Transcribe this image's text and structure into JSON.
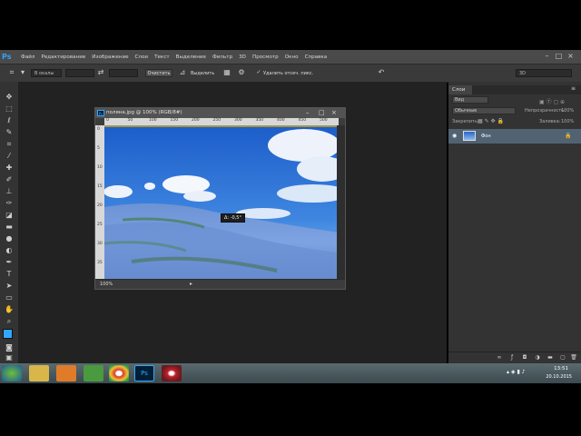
{
  "app": {
    "logo": "Ps",
    "menu": [
      "Файл",
      "Редактирование",
      "Изображение",
      "Слои",
      "Текст",
      "Выделение",
      "Фильтр",
      "3D",
      "Просмотр",
      "Окно",
      "Справка"
    ]
  },
  "options_bar": {
    "feather_label": "В окалы",
    "refine_button": "Очистить",
    "select_button": "Выделить",
    "checkbox_label": "Удалить отсеч. пикс.",
    "workspace_value": "3D"
  },
  "document": {
    "title": "поляна.jpg @ 100% (RGB/8#)",
    "zoom": "100%",
    "tooltip": "Δ: -0,5°",
    "ruler_top": [
      "0",
      "50",
      "100",
      "150",
      "200",
      "250",
      "300",
      "350",
      "400",
      "450",
      "500"
    ],
    "ruler_left": [
      "0",
      "5",
      "10",
      "15",
      "20",
      "25",
      "30",
      "35"
    ]
  },
  "layers_panel": {
    "tab_label": "Слои",
    "filter_label": "Вид",
    "blend_mode": "Обычные",
    "opacity_label": "Непрозрачность:",
    "opacity_value": "100%",
    "lock_label": "Закрепить:",
    "fill_label": "Заливка:",
    "fill_value": "100%",
    "layer_name": "Фон"
  },
  "taskbar": {
    "time": "13:51",
    "date": "20.10.2015"
  },
  "colors": {
    "accent": "#31a8ff",
    "sky": "#2f6fd1",
    "flowers": "#7da1e6",
    "layer_selected": "#516373"
  },
  "icons": [
    "crop-icon",
    "move-icon",
    "marquee-icon",
    "lasso-icon",
    "quick-select-icon",
    "eyedropper-icon",
    "brush-icon",
    "stamp-icon",
    "eraser-icon",
    "gradient-icon",
    "blur-icon",
    "dodge-icon",
    "pen-icon",
    "type-icon",
    "path-select-icon",
    "shape-icon",
    "hand-icon",
    "zoom-icon",
    "eye-icon",
    "lock-icon"
  ]
}
